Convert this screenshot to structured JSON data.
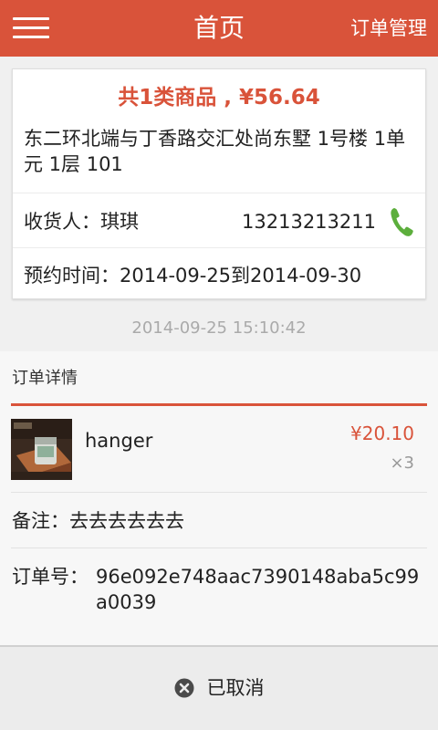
{
  "header": {
    "title": "首页",
    "right_action": "订单管理"
  },
  "order_card": {
    "summary": "共1类商品 , ¥56.64",
    "address": "东二环北端与丁香路交汇处尚东墅 1号楼 1单元 1层  101",
    "receiver_label": "收货人：琪琪",
    "receiver_phone": "13213213211",
    "appointment_time": "预约时间：2014-09-25到2014-09-30"
  },
  "timestamp": "2014-09-25 15:10:42",
  "detail": {
    "title": "订单详情",
    "items": [
      {
        "name": "hanger",
        "price": "¥20.10",
        "quantity": "×3"
      }
    ],
    "remark": "备注：去去去去去去",
    "order_no_label": "订单号：",
    "order_no_value": "96e092e748aac7390148aba5c99a0039"
  },
  "status": {
    "label": "已取消",
    "icon": "cancel-circle-icon"
  },
  "colors": {
    "accent": "#d9533a",
    "phone_green": "#5cae3c"
  }
}
